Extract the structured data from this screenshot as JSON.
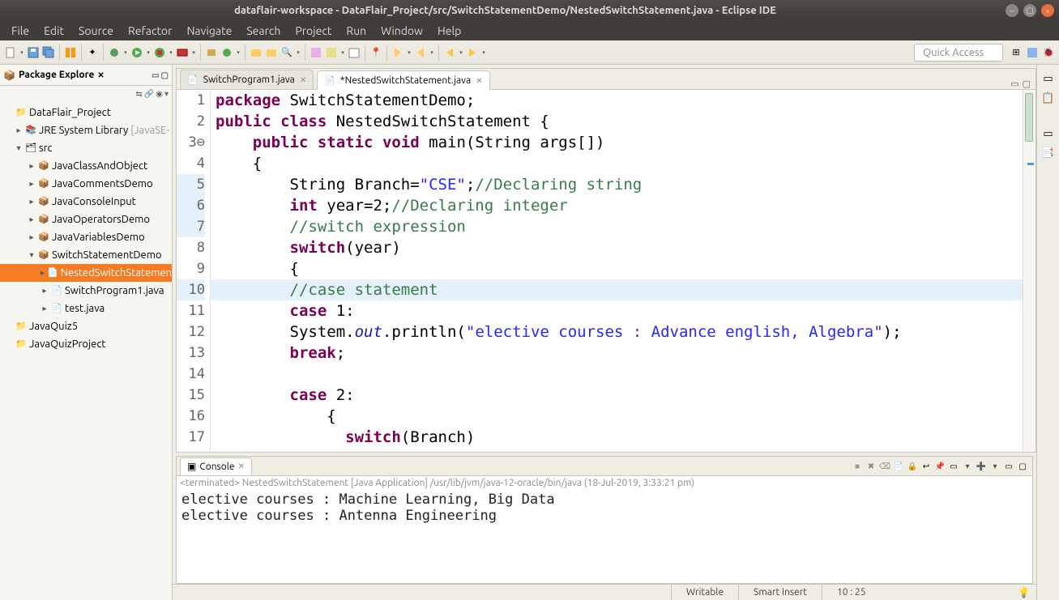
{
  "window": {
    "title": "dataflair-workspace - DataFlair_Project/src/SwitchStatementDemo/NestedSwitchStatement.java - Eclipse IDE"
  },
  "menu": [
    "File",
    "Edit",
    "Source",
    "Refactor",
    "Navigate",
    "Search",
    "Project",
    "Run",
    "Window",
    "Help"
  ],
  "quick_access_placeholder": "Quick Access",
  "package_explorer": {
    "title": "Package Explore",
    "items": [
      {
        "level": 1,
        "caret": "",
        "label": "DataFlair_Project",
        "icon": "proj"
      },
      {
        "level": 2,
        "caret": "▸",
        "label": "JRE System Library",
        "suffix": "[JavaSE-",
        "icon": "lib"
      },
      {
        "level": 2,
        "caret": "▾",
        "label": "src",
        "icon": "folder"
      },
      {
        "level": 3,
        "caret": "▸",
        "label": "JavaClassAndObject",
        "icon": "pkg"
      },
      {
        "level": 3,
        "caret": "▸",
        "label": "JavaCommentsDemo",
        "icon": "pkg"
      },
      {
        "level": 3,
        "caret": "▸",
        "label": "JavaConsoleInput",
        "icon": "pkg"
      },
      {
        "level": 3,
        "caret": "▸",
        "label": "JavaOperatorsDemo",
        "icon": "pkg"
      },
      {
        "level": 3,
        "caret": "▸",
        "label": "JavaVariablesDemo",
        "icon": "pkg"
      },
      {
        "level": 3,
        "caret": "▾",
        "label": "SwitchStatementDemo",
        "icon": "pkg"
      },
      {
        "level": 4,
        "caret": "▸",
        "label": "NestedSwitchStatemen",
        "icon": "jfile",
        "selected": true
      },
      {
        "level": 4,
        "caret": "▸",
        "label": "SwitchProgram1.java",
        "icon": "jfile"
      },
      {
        "level": 4,
        "caret": "▸",
        "label": "test.java",
        "icon": "jfile"
      },
      {
        "level": 1,
        "caret": "",
        "label": "JavaQuiz5",
        "icon": "proj"
      },
      {
        "level": 1,
        "caret": "",
        "label": "JavaQuizProject",
        "icon": "proj"
      }
    ]
  },
  "editor": {
    "tabs": [
      {
        "label": "SwitchProgram1.java",
        "active": false,
        "dirty": false
      },
      {
        "label": "*NestedSwitchStatement.java",
        "active": true,
        "dirty": true
      }
    ],
    "highlight_line": 10,
    "lines": [
      {
        "n": 1,
        "html": "<span class='kw'>package</span> SwitchStatementDemo;"
      },
      {
        "n": 2,
        "html": "<span class='kw'>public</span> <span class='kw'>class</span> NestedSwitchStatement {"
      },
      {
        "n": 3,
        "html": "    <span class='kw'>public</span> <span class='kw'>static</span> <span class='kw'>void</span> main(String args[])"
      },
      {
        "n": 4,
        "html": "    {"
      },
      {
        "n": 5,
        "html": "        String Branch=<span class='str'>\"CSE\"</span>;<span class='com'>//Declaring string</span>"
      },
      {
        "n": 6,
        "html": "        <span class='kw'>int</span> year=2;<span class='com'>//Declaring integer</span>"
      },
      {
        "n": 7,
        "html": "        <span class='com'>//switch expression</span>"
      },
      {
        "n": 8,
        "html": "        <span class='kw'>switch</span>(year)"
      },
      {
        "n": 9,
        "html": "        {"
      },
      {
        "n": 10,
        "html": "        <span class='com'>//case statement</span>"
      },
      {
        "n": 11,
        "html": "        <span class='kw'>case</span> 1:"
      },
      {
        "n": 12,
        "html": "        System.<span class='field'>out</span>.println(<span class='str'>\"elective courses : Advance english, Algebra\"</span>);"
      },
      {
        "n": 13,
        "html": "        <span class='kw'>break</span>;"
      },
      {
        "n": 14,
        "html": ""
      },
      {
        "n": 15,
        "html": "        <span class='kw'>case</span> 2:"
      },
      {
        "n": 16,
        "html": "            {"
      },
      {
        "n": 17,
        "html": "              <span class='kw'>switch</span>(Branch)"
      }
    ]
  },
  "console": {
    "title": "Console",
    "header": "<terminated> NestedSwitchStatement [Java Application] /usr/lib/jvm/java-12-oracle/bin/java (18-Jul-2019, 3:33:21 pm)",
    "output": [
      "elective courses : Machine Learning, Big Data",
      "elective courses : Antenna Engineering"
    ]
  },
  "status": {
    "writable": "Writable",
    "insert": "Smart Insert",
    "cursor": "10 : 25"
  }
}
